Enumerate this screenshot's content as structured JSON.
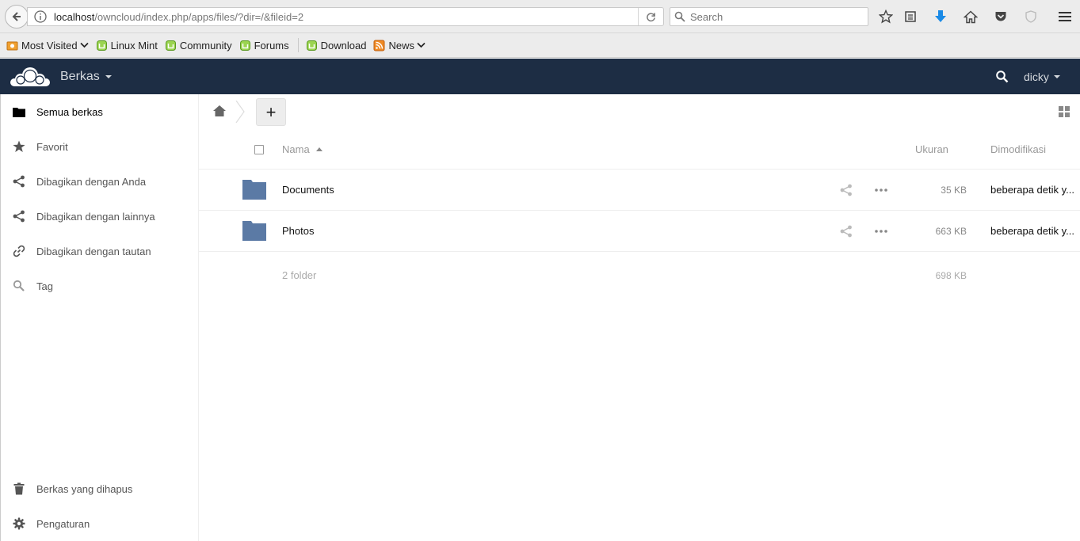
{
  "browser": {
    "url_host": "localhost",
    "url_path": "/owncloud/index.php/apps/files/?dir=/&fileid=2",
    "search_placeholder": "Search"
  },
  "bookmarks": [
    {
      "label": "Most Visited",
      "icon": "most-visited-icon",
      "dropdown": true
    },
    {
      "label": "Linux Mint",
      "icon": "mint-icon",
      "dropdown": false
    },
    {
      "label": "Community",
      "icon": "mint-icon",
      "dropdown": false
    },
    {
      "label": "Forums",
      "icon": "mint-icon",
      "dropdown": false
    },
    {
      "label": "Download",
      "icon": "mint-icon",
      "dropdown": false
    },
    {
      "label": "News",
      "icon": "rss-icon",
      "dropdown": true
    }
  ],
  "header": {
    "app_name": "Berkas",
    "user": "dicky",
    "bg_color": "#1d2d44"
  },
  "sidebar": {
    "items": [
      {
        "label": "Semua berkas",
        "icon": "folder-icon",
        "active": true
      },
      {
        "label": "Favorit",
        "icon": "star-icon",
        "active": false
      },
      {
        "label": "Dibagikan dengan Anda",
        "icon": "share-icon",
        "active": false
      },
      {
        "label": "Dibagikan dengan lainnya",
        "icon": "share-icon",
        "active": false
      },
      {
        "label": "Dibagikan dengan tautan",
        "icon": "link-icon",
        "active": false
      },
      {
        "label": "Tag",
        "icon": "tag-search-icon",
        "active": false
      }
    ],
    "bottom_items": [
      {
        "label": "Berkas yang dihapus",
        "icon": "trash-icon"
      },
      {
        "label": "Pengaturan",
        "icon": "gear-icon"
      }
    ]
  },
  "content": {
    "new_label": "+",
    "columns": {
      "name": "Nama",
      "size": "Ukuran",
      "modified": "Dimodifikasi"
    },
    "files": [
      {
        "name": "Documents",
        "size": "35 KB",
        "modified": "beberapa detik y..."
      },
      {
        "name": "Photos",
        "size": "663 KB",
        "modified": "beberapa detik y..."
      }
    ],
    "summary": {
      "count": "2 folder",
      "size": "698 KB"
    },
    "folder_color": "#5b7aa5"
  }
}
